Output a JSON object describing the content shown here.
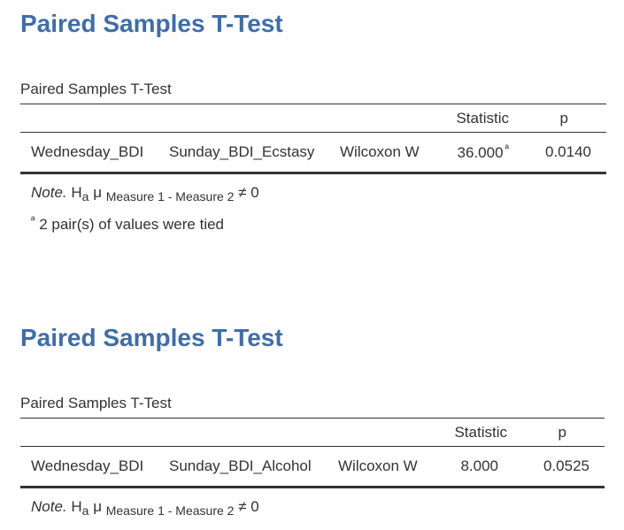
{
  "analyses": [
    {
      "heading": "Paired Samples T-Test",
      "table_title": "Paired Samples T-Test",
      "columns": {
        "statistic": "Statistic",
        "p": "p"
      },
      "row": {
        "measure1": "Wednesday_BDI",
        "measure2": "Sunday_BDI_Ecstasy",
        "test": "Wilcoxon W",
        "statistic": "36.000",
        "statistic_footnote": "ª",
        "p": "0.0140"
      },
      "note": {
        "label": "Note.",
        "h": "H",
        "h_sub": "a",
        "mu": "μ",
        "mu_sub": "Measure 1 - Measure 2",
        "tail": "≠ 0"
      },
      "footnote": {
        "marker": "ª",
        "text": "2 pair(s) of values were tied"
      }
    },
    {
      "heading": "Paired Samples T-Test",
      "table_title": "Paired Samples T-Test",
      "columns": {
        "statistic": "Statistic",
        "p": "p"
      },
      "row": {
        "measure1": "Wednesday_BDI",
        "measure2": "Sunday_BDI_Alcohol",
        "test": "Wilcoxon W",
        "statistic": "8.000",
        "p": "0.0525"
      },
      "note": {
        "label": "Note.",
        "h": "H",
        "h_sub": "a",
        "mu": "μ",
        "mu_sub": "Measure 1 - Measure 2",
        "tail": "≠ 0"
      }
    }
  ]
}
